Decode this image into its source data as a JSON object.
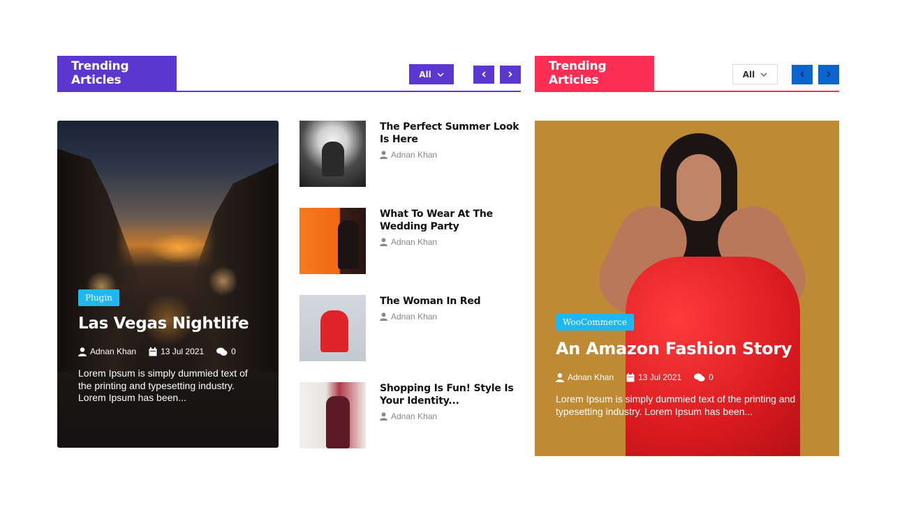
{
  "left_widget": {
    "title": "Trending Articles",
    "filter_label": "All",
    "feature": {
      "category": "Plugin",
      "title": "Las Vegas Nightlife",
      "author": "Adnan Khan",
      "date": "13 Jul 2021",
      "comments": "0",
      "excerpt": "Lorem Ipsum is simply dummied text of the printing and typesetting industry. Lorem Ipsum has been..."
    },
    "list": [
      {
        "title": "The Perfect Summer Look Is Here",
        "author": "Adnan Khan"
      },
      {
        "title": "What To Wear At The Wedding Party",
        "author": "Adnan Khan"
      },
      {
        "title": "The Woman In Red",
        "author": "Adnan Khan"
      },
      {
        "title": "Shopping Is Fun! Style Is Your Identity...",
        "author": "Adnan Khan"
      }
    ]
  },
  "right_widget": {
    "title": "Trending Articles",
    "filter_label": "All",
    "feature": {
      "category": "WooCommerce",
      "title": "An Amazon Fashion Story",
      "author": "Adnan Khan",
      "date": "13 Jul 2021",
      "comments": "0",
      "excerpt": "Lorem Ipsum is simply dummied text of the printing and typesetting industry. Lorem Ipsum has been..."
    }
  },
  "colors": {
    "left_accent": "#5b36cf",
    "right_accent": "#fb2d55",
    "badge_blue": "#1db7f2",
    "right_nav_blue": "#0b63ce"
  },
  "icons": {
    "user": "user-icon",
    "calendar": "calendar-icon",
    "comments": "comments-icon",
    "chevron_down": "chevron-down-icon",
    "prev": "chevron-left-icon",
    "next": "chevron-right-icon"
  }
}
